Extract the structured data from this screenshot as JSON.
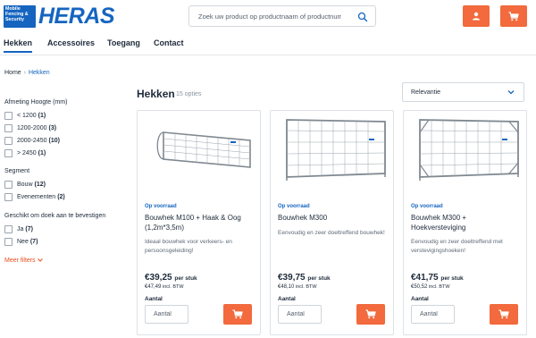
{
  "header": {
    "logo_small": "Mobile\nFencing &\nSecurity",
    "logo_word": "HERAS",
    "search_placeholder": "Zoek uw product op productnaam of productnummer"
  },
  "nav": [
    "Hekken",
    "Accessoires",
    "Toegang",
    "Contact"
  ],
  "breadcrumb": {
    "home": "Home",
    "sep": "›",
    "current": "Hekken"
  },
  "filters": {
    "height": {
      "title": "Afmeting Hoogte (mm)",
      "options": [
        {
          "label": "< 1200",
          "count": "(1)"
        },
        {
          "label": "1200-2000",
          "count": "(3)"
        },
        {
          "label": "2000-2450",
          "count": "(10)"
        },
        {
          "label": "> 2450",
          "count": "(1)"
        }
      ]
    },
    "segment": {
      "title": "Segment",
      "options": [
        {
          "label": "Bouw",
          "count": "(12)"
        },
        {
          "label": "Evenementen",
          "count": "(2)"
        }
      ]
    },
    "mesh": {
      "title": "Geschikt om doek aan te bevestigen",
      "options": [
        {
          "label": "Ja",
          "count": "(7)"
        },
        {
          "label": "Nee",
          "count": "(7)"
        }
      ]
    },
    "more": "Meer filters"
  },
  "listing": {
    "title": "Hekken",
    "count": "15 opties",
    "sort": "Relevantie"
  },
  "products": [
    {
      "stock": "Op voorraad",
      "name": "Bouwhek M100 + Haak & Oog (1,2m*3,5m)",
      "desc": "Ideaal bouwhek voor verkeers- en persoonsgeleiding!",
      "price": "€39,25",
      "per": "per stuk",
      "incl": "€47,49",
      "incl_label": "incl. BTW",
      "qty_label": "Aantal",
      "qty_placeholder": "Aantal"
    },
    {
      "stock": "Op voorraad",
      "name": "Bouwhek M300",
      "desc": "Eenvoudig en zeer doeltreffend bouwhek!",
      "price": "€39,75",
      "per": "per stuk",
      "incl": "€48,10",
      "incl_label": "incl. BTW",
      "qty_label": "Aantal",
      "qty_placeholder": "Aantal"
    },
    {
      "stock": "Op voorraad",
      "name": "Bouwhek M300 + Hoekversteviging",
      "desc": "Eenvoudig en zeer doeltreffend met verstevigingshoeken!",
      "price": "€41,75",
      "per": "per stuk",
      "incl": "€50,52",
      "incl_label": "incl. BTW",
      "qty_label": "Aantal",
      "qty_placeholder": "Aantal"
    }
  ],
  "icons": {
    "user": "user-icon",
    "cart": "cart-icon",
    "search": "search-icon",
    "chevron": "chevron-down-icon"
  },
  "colors": {
    "brand": "#1565c0",
    "accent": "#f26a3d",
    "link": "#e84d1c"
  }
}
